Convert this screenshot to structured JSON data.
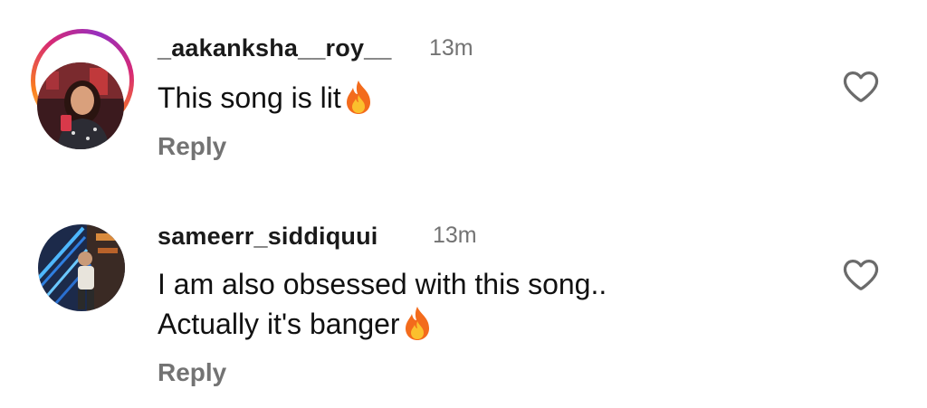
{
  "comments": [
    {
      "username": "_aakanksha__roy__",
      "time": "13m",
      "lines": [
        "This song is lit"
      ],
      "emoji": "flame-icon",
      "reply_label": "Reply",
      "has_story_ring": true
    },
    {
      "username": "sameerr_siddiquui",
      "time": "13m",
      "lines": [
        "I am also obsessed with this song..",
        "Actually it's banger"
      ],
      "emoji": "flame-icon",
      "reply_label": "Reply",
      "has_story_ring": false
    }
  ],
  "icons": {
    "like": "heart-outline-icon",
    "emoji": "flame-icon"
  },
  "colors": {
    "username": "#1a1a1a",
    "muted": "#737373",
    "ring_gradient": [
      "#feda75",
      "#fa7e1e",
      "#d62976",
      "#962fbf"
    ]
  }
}
